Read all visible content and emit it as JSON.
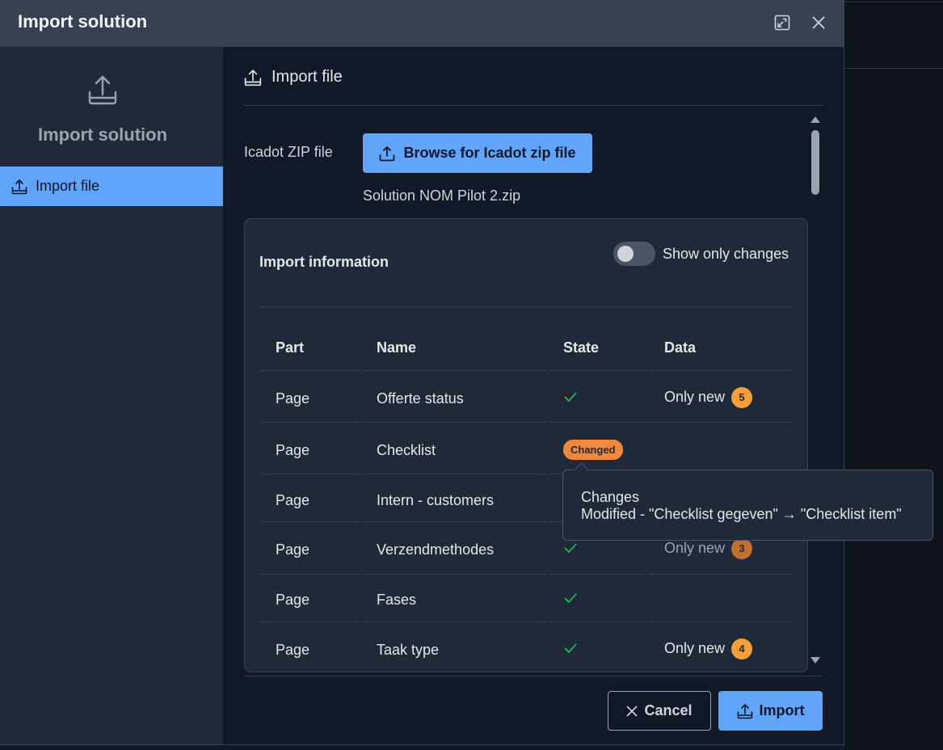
{
  "dialog": {
    "title": "Import solution",
    "icons": {
      "expand": "expand-icon",
      "close": "close-icon"
    }
  },
  "sidebar": {
    "icon": "upload-tray-icon",
    "title": "Import solution",
    "items": [
      {
        "label": "Import file",
        "icon": "upload-tray-icon",
        "active": true
      }
    ]
  },
  "section": {
    "title": "Import file",
    "zip_label": "Icadot ZIP file",
    "browse_label": "Browse for Icadot zip file",
    "file_name": "Solution NOM Pilot 2.zip"
  },
  "import_info": {
    "title": "Import information",
    "toggle_label": "Show only changes",
    "toggle_on": false,
    "columns": [
      "Part",
      "Name",
      "State",
      "Data"
    ],
    "rows": [
      {
        "part": "Page",
        "name": "Offerte status",
        "state": "check",
        "data": "Only new",
        "count": "5"
      },
      {
        "part": "Page",
        "name": "Checklist",
        "state": "Changed",
        "data": "",
        "count": ""
      },
      {
        "part": "Page",
        "name": "Intern - customers",
        "state": "",
        "data": "",
        "count": ""
      },
      {
        "part": "Page",
        "name": "Verzendmethodes",
        "state": "check",
        "data": "Only new",
        "count": "3"
      },
      {
        "part": "Page",
        "name": "Fases",
        "state": "check",
        "data": "",
        "count": ""
      },
      {
        "part": "Page",
        "name": "Taak type",
        "state": "check",
        "data": "Only new",
        "count": "4"
      }
    ]
  },
  "tooltip": {
    "title": "Changes",
    "detail": "Modified - \"Checklist gegeven\" → \"Checklist item\""
  },
  "footer": {
    "cancel_label": "Cancel",
    "import_label": "Import"
  },
  "colors": {
    "accent": "#60a5fa",
    "badge": "#f59e3b",
    "changed": "#f0883e",
    "check": "#22c55e"
  }
}
